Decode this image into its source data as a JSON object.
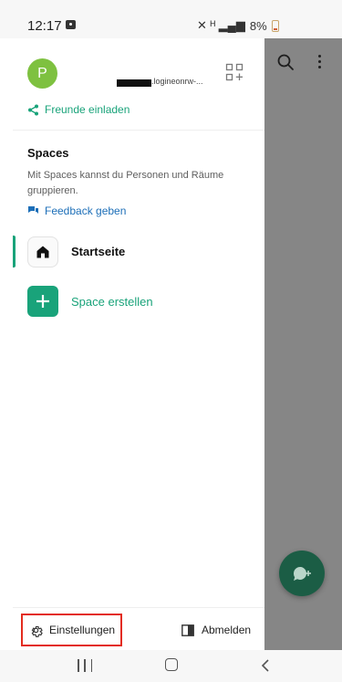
{
  "status_bar": {
    "time": "12:17",
    "indicators": "✕ ᴱ ▁▃▅ 8%",
    "battery": "8%"
  },
  "drawer": {
    "avatar_letter": "P",
    "user_id": ".logineonrw-...",
    "invite_label": "Freunde einladen",
    "spaces_title": "Spaces",
    "spaces_description": "Mit Spaces kannst du Personen und Räume gruppieren.",
    "feedback_label": "Feedback geben",
    "home_label": "Startseite",
    "create_space_label": "Space erstellen",
    "settings_label": "Einstellungen",
    "logout_label": "Abmelden"
  },
  "icons": {
    "qr": "qr-code-icon",
    "share": "share-icon",
    "feedback": "chat-bubble-icon",
    "home": "home-icon",
    "add": "plus-icon",
    "settings": "gear-icon",
    "logout": "logout-icon",
    "search": "search-icon",
    "more": "more-vert-icon",
    "new_chat": "new-chat-icon"
  },
  "colors": {
    "accent": "#19a37a",
    "link_blue": "#1d6fb8",
    "avatar": "#7ec140",
    "fab": "#1b5d45",
    "highlight_box": "#e32c1e",
    "scrim": "#868686"
  }
}
